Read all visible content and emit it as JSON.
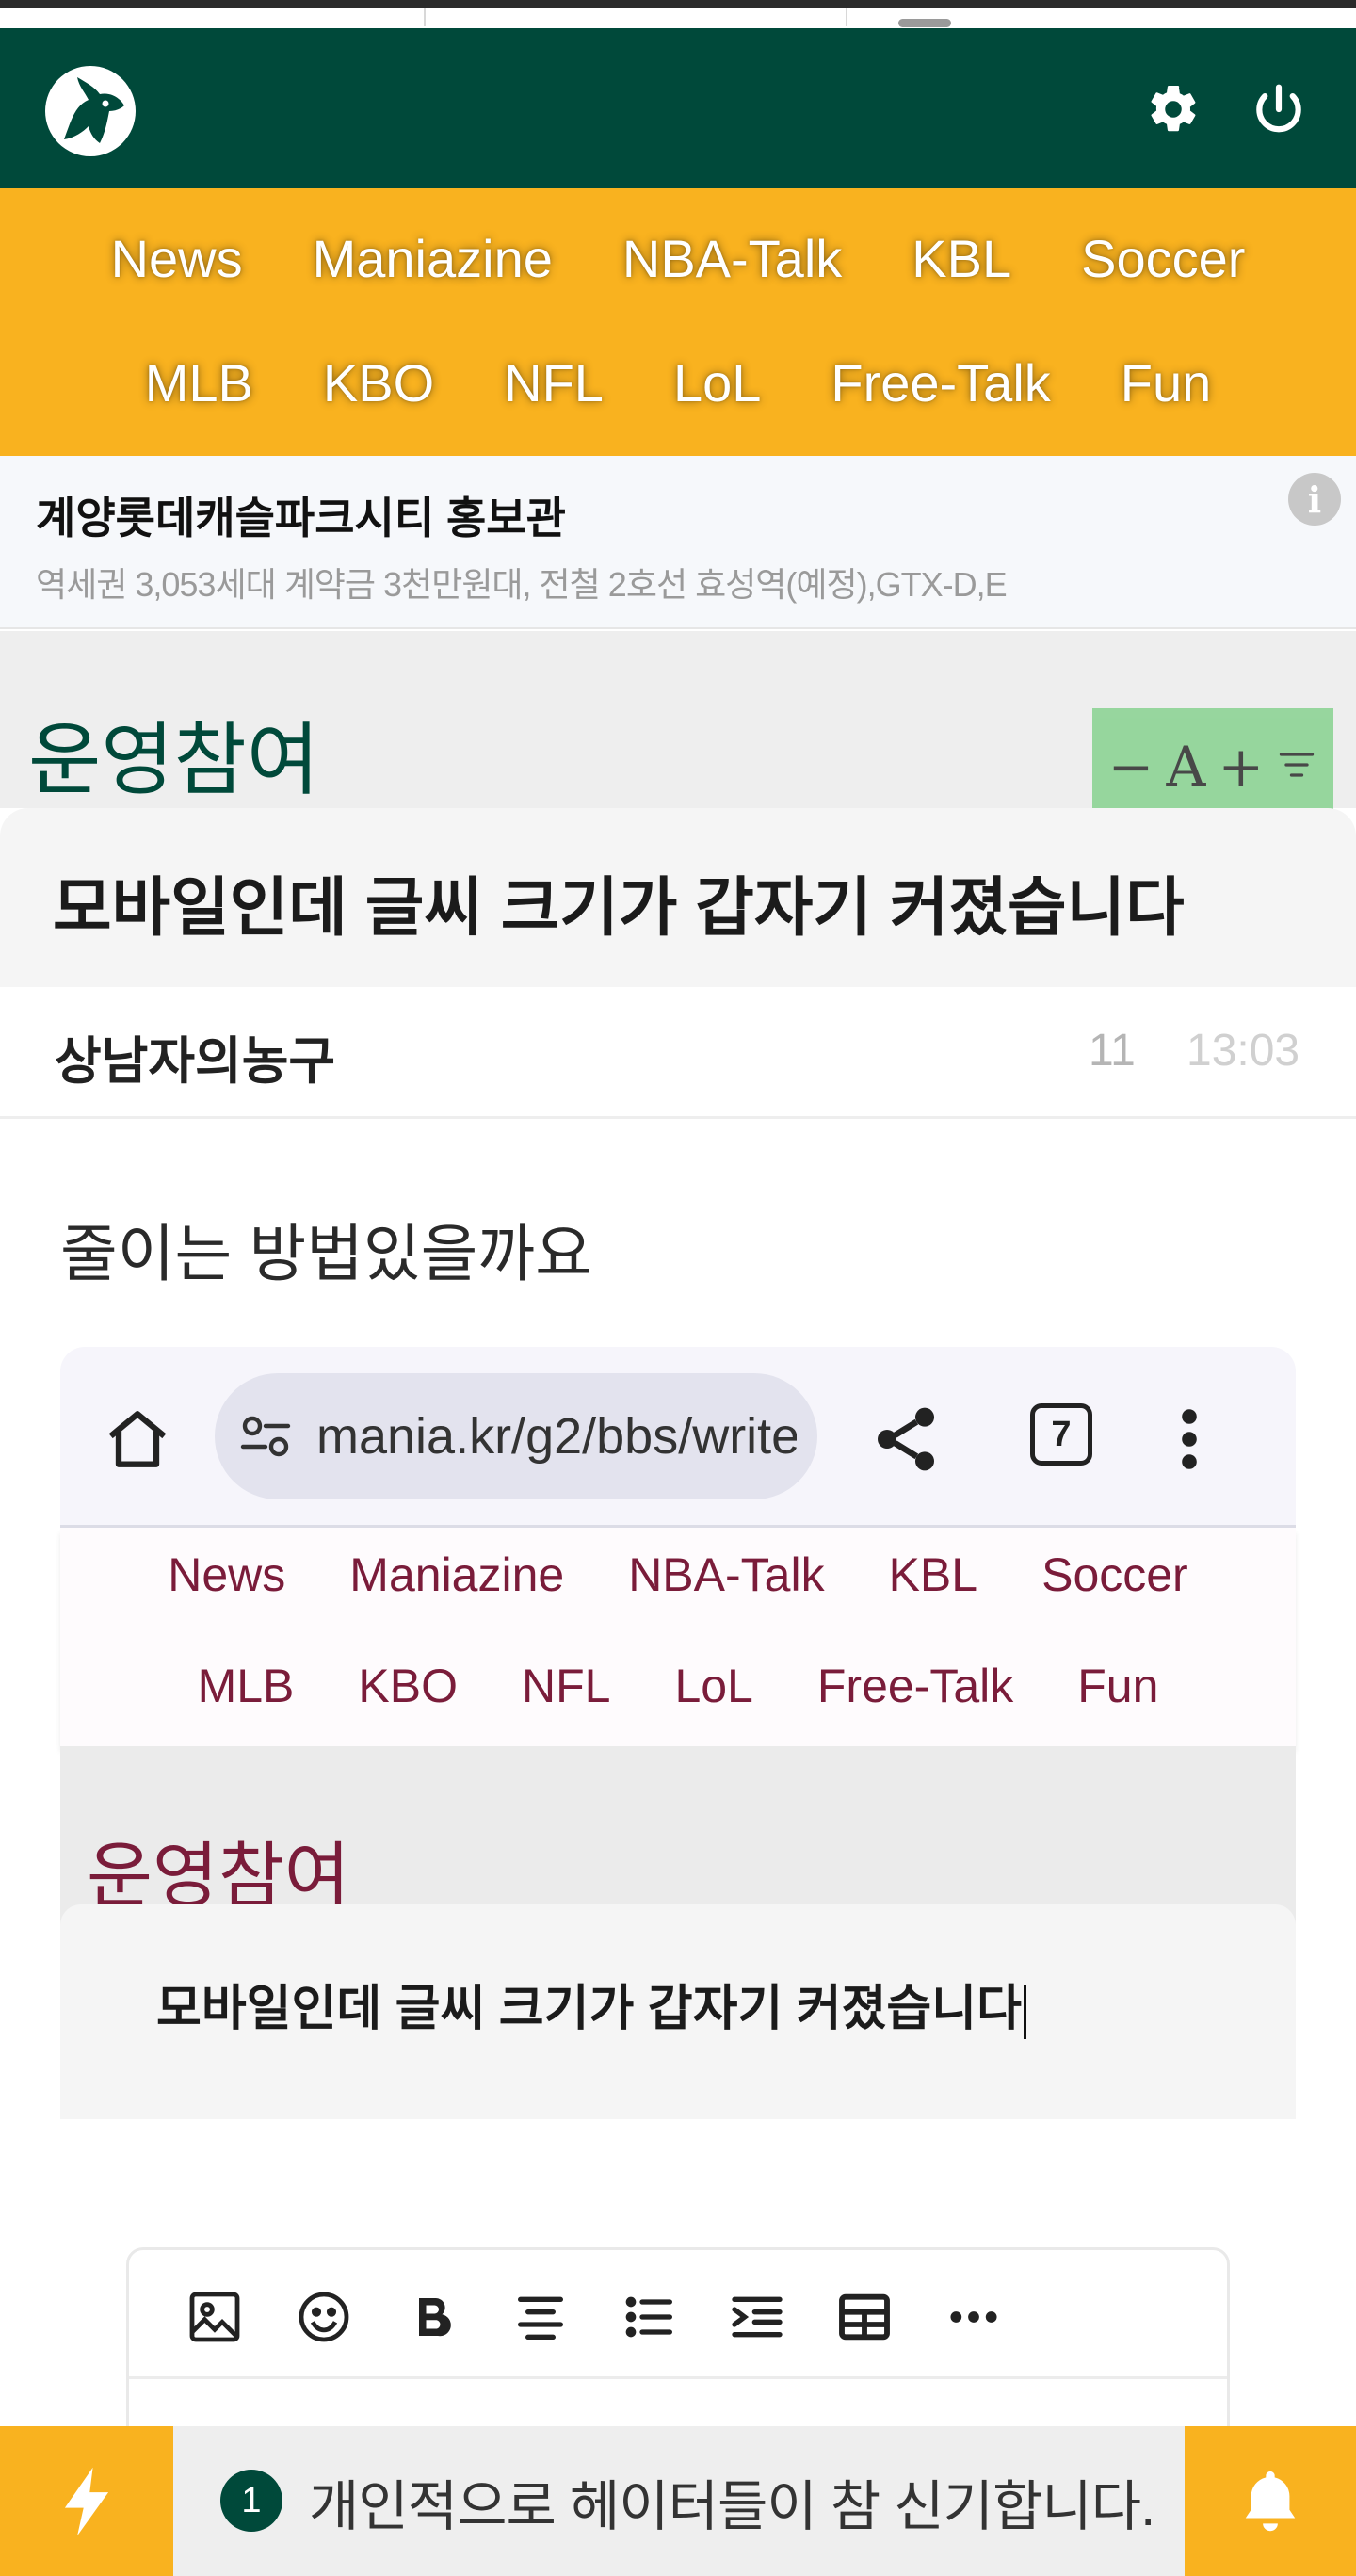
{
  "nav": {
    "row1": [
      "News",
      "Maniazine",
      "NBA-Talk",
      "KBL",
      "Soccer"
    ],
    "row2": [
      "MLB",
      "KBO",
      "NFL",
      "LoL",
      "Free-Talk",
      "Fun"
    ]
  },
  "ad": {
    "title": "계양롯데캐슬파크시티 홍보관",
    "subtitle": "역세권 3,053세대 계약금 3천만원대, 전철 2호선 효성역(예정),GTX-D,E",
    "info_glyph": "i"
  },
  "board": {
    "title": "운영참여",
    "font_controls": {
      "minus": "−",
      "a": "A",
      "plus": "+",
      "sort": "≡"
    }
  },
  "post": {
    "title": "모바일인데 글씨 크기가 갑자기 커졌습니다",
    "author": "상남자의농구",
    "views": "11",
    "time": "13:03",
    "body": "줄이는 방법있을까요"
  },
  "screenshot": {
    "url": "mania.kr/g2/bbs/write",
    "tab_count": "7",
    "nav_row1": [
      "News",
      "Maniazine",
      "NBA-Talk",
      "KBL",
      "Soccer"
    ],
    "nav_row2": [
      "MLB",
      "KBO",
      "NFL",
      "LoL",
      "Free-Talk",
      "Fun"
    ],
    "board_title": "운영참여",
    "post_title": "모바일인데 글씨 크기가 갑자기 커졌습니다"
  },
  "editor": {
    "tools": [
      "image-icon",
      "emoji-icon",
      "bold-icon",
      "align-center-icon",
      "bullet-list-icon",
      "indent-icon",
      "table-icon",
      "more-icon"
    ]
  },
  "notice": {
    "badge": "1",
    "text": "개인적으로 헤이터들이 참 신기합니다."
  },
  "colors": {
    "brand_green": "#00493a",
    "brand_yellow": "#f9b21f",
    "shot_accent": "#7a1c3a"
  }
}
